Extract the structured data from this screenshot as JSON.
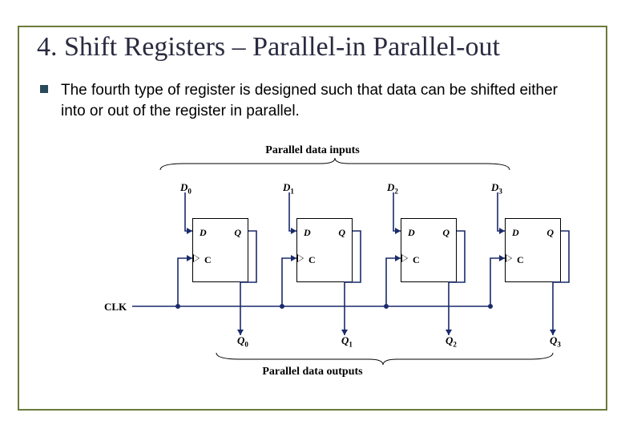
{
  "title": "4. Shift Registers – Parallel-in Parallel-out",
  "body_text": "The fourth type of register is designed such that data can be shifted either into or out of the register in parallel.",
  "top_label": "Parallel data inputs",
  "bottom_label": "Parallel data outputs",
  "clk_label": "CLK",
  "inputs": [
    "D",
    "D",
    "D",
    "D"
  ],
  "input_subs": [
    "0",
    "1",
    "2",
    "3"
  ],
  "outputs": [
    "Q",
    "Q",
    "Q",
    "Q"
  ],
  "output_subs": [
    "0",
    "1",
    "2",
    "3"
  ],
  "ff": {
    "d": "D",
    "q": "Q",
    "c": "C"
  },
  "diagram": {
    "type": "shift-register-PIPO",
    "flipflops": 4,
    "pins_per_ff": [
      "D",
      "Q",
      "C"
    ],
    "clock_shared": true,
    "inputs": [
      "D0",
      "D1",
      "D2",
      "D3"
    ],
    "outputs": [
      "Q0",
      "Q1",
      "Q2",
      "Q3"
    ]
  }
}
